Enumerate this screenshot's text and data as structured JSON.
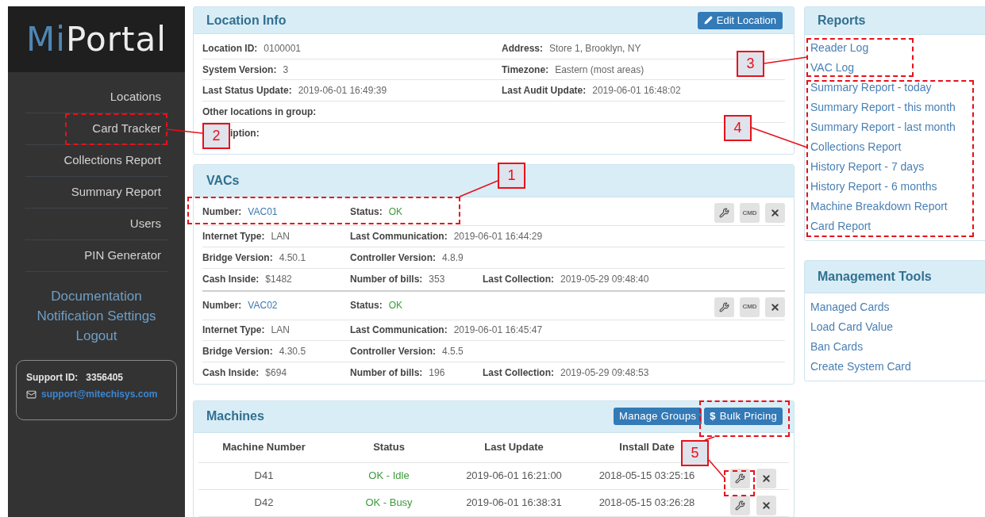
{
  "sidebar": {
    "logo": {
      "accent": "Mi",
      "rest": "Portal"
    },
    "nav": [
      "Locations",
      "Card Tracker",
      "Collections Report",
      "Summary Report",
      "Users",
      "PIN Generator"
    ],
    "links": [
      "Documentation",
      "Notification Settings",
      "Logout"
    ],
    "support": {
      "label": "Support ID:",
      "id": "3356405",
      "email": "support@mitechisys.com"
    }
  },
  "location_info": {
    "title": "Location Info",
    "edit_button": "Edit Location",
    "rows": [
      [
        {
          "label": "Location ID:",
          "value": "0100001"
        },
        {
          "label": "Address:",
          "value": "Store 1, Brooklyn, NY"
        }
      ],
      [
        {
          "label": "System Version:",
          "value": "3"
        },
        {
          "label": "Timezone:",
          "value": "Eastern (most areas)"
        }
      ],
      [
        {
          "label": "Last Status Update:",
          "value": "2019-06-01 16:49:39"
        },
        {
          "label": "Last Audit Update:",
          "value": "2019-06-01 16:48:02"
        }
      ],
      [
        {
          "label": "Other locations in group:"
        }
      ],
      [
        {
          "label": "iption:"
        }
      ]
    ]
  },
  "vacs": {
    "title": "VACs",
    "units": [
      {
        "rows": [
          [
            {
              "label": "Number:",
              "value": "VAC01",
              "kind": "link"
            },
            {
              "label": "Status:",
              "value": "OK",
              "kind": "ok"
            }
          ],
          [
            {
              "label": "Internet Type:",
              "value": "LAN"
            },
            {
              "label": "Last Communication:",
              "value": "2019-06-01 16:44:29"
            }
          ],
          [
            {
              "label": "Bridge Version:",
              "value": "4.50.1"
            },
            {
              "label": "Controller Version:",
              "value": "4.8.9"
            }
          ],
          [
            {
              "label": "Cash Inside:",
              "value": "$1482"
            },
            {
              "label": "Number of bills:",
              "value": "353"
            },
            {
              "label": "Last Collection:",
              "value": "2019-05-29 09:48:40"
            }
          ]
        ],
        "buttons": [
          {
            "kind": "wrench"
          },
          {
            "kind": "text",
            "label": "CMD"
          },
          {
            "kind": "close"
          }
        ]
      },
      {
        "rows": [
          [
            {
              "label": "Number:",
              "value": "VAC02",
              "kind": "link"
            },
            {
              "label": "Status:",
              "value": "OK",
              "kind": "ok"
            }
          ],
          [
            {
              "label": "Internet Type:",
              "value": "LAN"
            },
            {
              "label": "Last Communication:",
              "value": "2019-06-01 16:45:47"
            }
          ],
          [
            {
              "label": "Bridge Version:",
              "value": "4.30.5"
            },
            {
              "label": "Controller Version:",
              "value": "4.5.5"
            }
          ],
          [
            {
              "label": "Cash Inside:",
              "value": "$694"
            },
            {
              "label": "Number of bills:",
              "value": "196"
            },
            {
              "label": "Last Collection:",
              "value": "2019-05-29 09:48:53"
            }
          ]
        ],
        "buttons": [
          {
            "kind": "wrench"
          },
          {
            "kind": "text",
            "label": "CMD"
          },
          {
            "kind": "close"
          }
        ]
      }
    ]
  },
  "machines": {
    "title": "Machines",
    "buttons": [
      {
        "label": "Manage Groups"
      },
      {
        "icon": "$",
        "label": "Bulk Pricing"
      }
    ],
    "columns": [
      "Machine Number",
      "Status",
      "Last Update",
      "Install Date"
    ],
    "rows": [
      {
        "cells": [
          "D41",
          "OK - Idle",
          "2019-06-01 16:21:00",
          "2018-05-15 03:25:16"
        ],
        "buttons": [
          {
            "kind": "wrench"
          },
          {
            "kind": "close"
          }
        ]
      },
      {
        "cells": [
          "D42",
          "OK - Busy",
          "2019-06-01 16:38:31",
          "2018-05-15 03:26:28"
        ],
        "buttons": [
          {
            "kind": "wrench"
          },
          {
            "kind": "close"
          }
        ]
      }
    ]
  },
  "reports": {
    "title": "Reports",
    "links": [
      "Reader Log",
      "VAC Log",
      "Summary Report - today",
      "Summary Report - this month",
      "Summary Report - last month",
      "Collections Report",
      "History Report - 7 days",
      "History Report - 6 months",
      "Machine Breakdown Report",
      "Card Report"
    ]
  },
  "management_tools": {
    "title": "Management Tools",
    "links": [
      "Managed Cards",
      "Load Card Value",
      "Ban Cards",
      "Create System Card"
    ]
  },
  "annotations": [
    "1",
    "2",
    "3",
    "4",
    "5"
  ]
}
